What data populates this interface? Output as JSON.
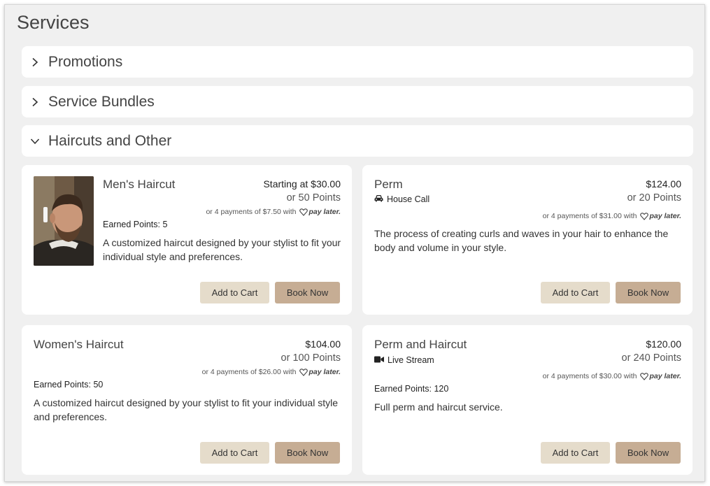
{
  "page": {
    "title": "Services"
  },
  "accordions": [
    {
      "label": "Promotions",
      "expanded": false
    },
    {
      "label": "Service Bundles",
      "expanded": false
    },
    {
      "label": "Haircuts and Other",
      "expanded": true
    }
  ],
  "services": [
    {
      "name": "Men's Haircut",
      "price": "Starting at $30.00",
      "points": "or 50 Points",
      "paylater": "or 4 payments of $7.50 with",
      "paylater_brand": "pay later.",
      "earned": "Earned Points: 5",
      "description": "A customized haircut designed by your stylist to fit your individual style and preferences.",
      "add_label": "Add to Cart",
      "book_label": "Book Now"
    },
    {
      "name": "Perm",
      "tag": "House Call",
      "tag_icon": "car-icon",
      "price": "$124.00",
      "points": "or 20 Points",
      "paylater": "or 4 payments of $31.00 with",
      "paylater_brand": "pay later.",
      "description": "The process of creating curls and waves in your hair to enhance the body and volume in your style.",
      "add_label": "Add to Cart",
      "book_label": "Book Now"
    },
    {
      "name": "Women's Haircut",
      "price": "$104.00",
      "points": "or 100 Points",
      "paylater": "or 4 payments of $26.00 with",
      "paylater_brand": "pay later.",
      "earned": "Earned Points: 50",
      "description": "A customized haircut designed by your stylist to fit your individual style and preferences.",
      "add_label": "Add to Cart",
      "book_label": "Book Now"
    },
    {
      "name": "Perm and Haircut",
      "tag": "Live Stream",
      "tag_icon": "video-camera-icon",
      "price": "$120.00",
      "points": "or 240 Points",
      "paylater": "or 4 payments of $30.00 with",
      "paylater_brand": "pay later.",
      "earned": "Earned Points: 120",
      "description": "Full perm and haircut service.",
      "add_label": "Add to Cart",
      "book_label": "Book Now"
    }
  ],
  "colors": {
    "background": "#f0f0f0",
    "card": "#ffffff",
    "add_button": "#e5dccb",
    "book_button": "#c6ad94"
  }
}
